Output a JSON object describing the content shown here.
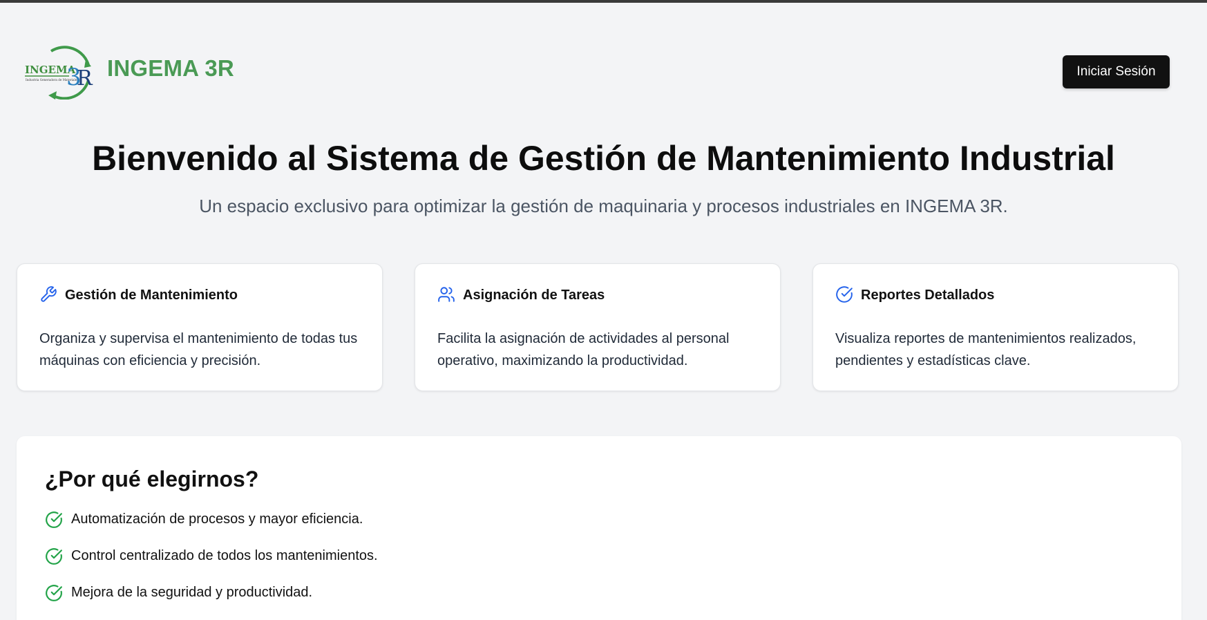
{
  "header": {
    "brand_name": "INGEMA 3R",
    "logo_text": "INGEMA 3R",
    "login_label": "Iniciar Sesión"
  },
  "hero": {
    "title": "Bienvenido al Sistema de Gestión de Mantenimiento Industrial",
    "subtitle": "Un espacio exclusivo para optimizar la gestión de maquinaria y procesos industriales en INGEMA 3R."
  },
  "features": [
    {
      "icon": "wrench-icon",
      "title": "Gestión de Mantenimiento",
      "description": "Organiza y supervisa el mantenimiento de todas tus máquinas con eficiencia y precisión."
    },
    {
      "icon": "users-icon",
      "title": "Asignación de Tareas",
      "description": "Facilita la asignación de actividades al personal operativo, maximizando la productividad."
    },
    {
      "icon": "check-circle-icon",
      "title": "Reportes Detallados",
      "description": "Visualiza reportes de mantenimientos realizados, pendientes y estadísticas clave."
    }
  ],
  "why": {
    "title": "¿Por qué elegirnos?",
    "items": [
      "Automatización de procesos y mayor eficiencia.",
      "Control centralizado de todos los mantenimientos.",
      "Mejora de la seguridad y productividad."
    ]
  },
  "colors": {
    "brand_green": "#4a9a55",
    "accent_blue": "#2563eb",
    "check_green": "#22a348",
    "button_dark": "#111111",
    "background": "#f3f4f6"
  }
}
